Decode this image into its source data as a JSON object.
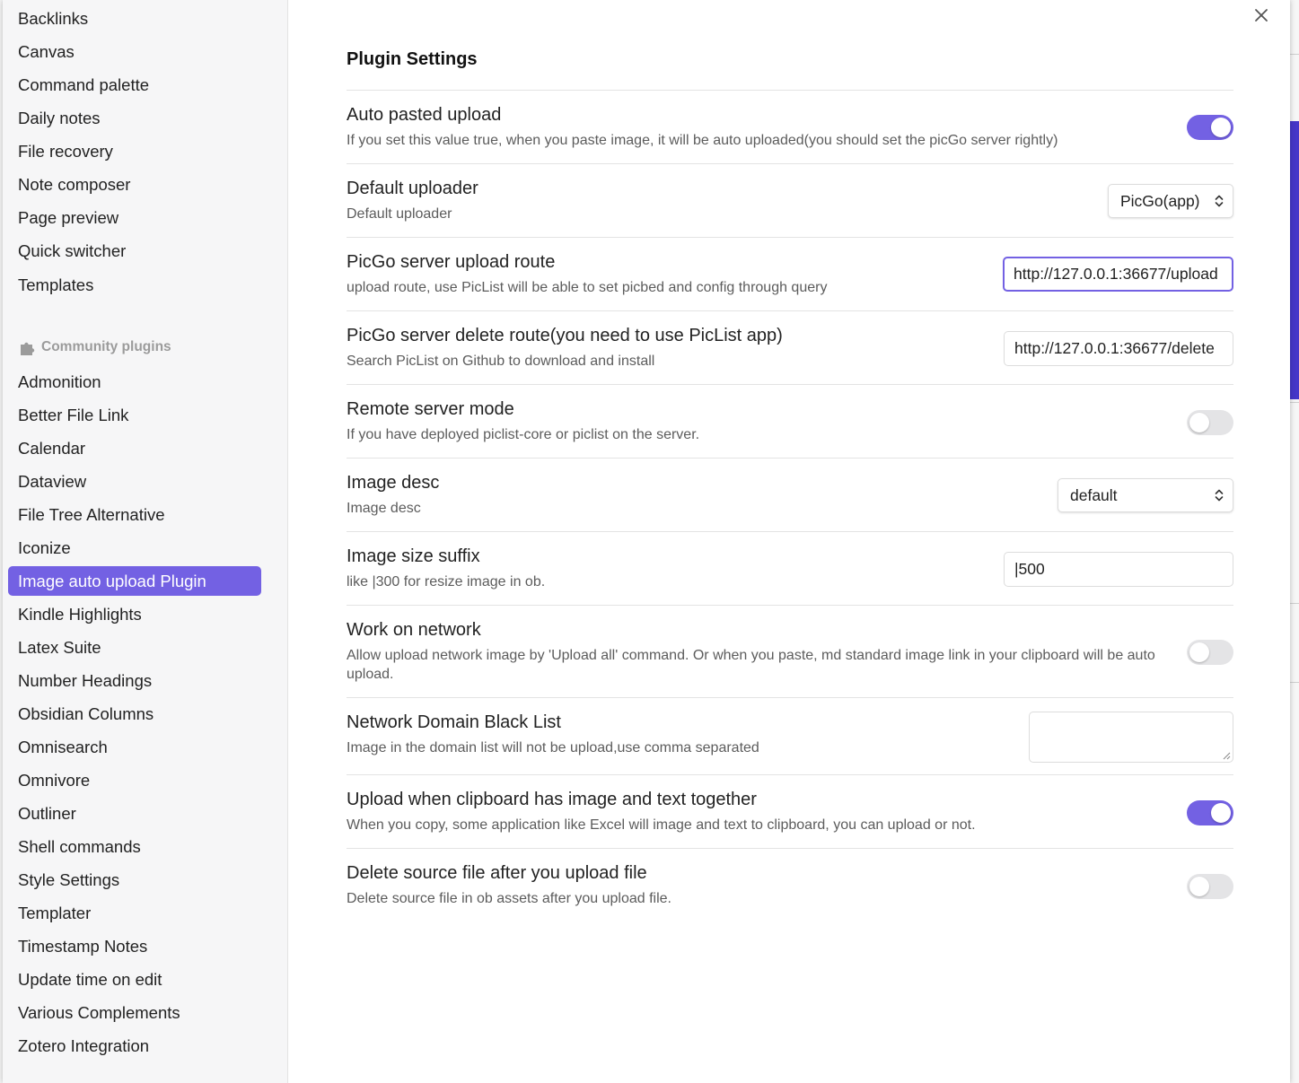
{
  "sidebar": {
    "core_items": [
      "Backlinks",
      "Canvas",
      "Command palette",
      "Daily notes",
      "File recovery",
      "Note composer",
      "Page preview",
      "Quick switcher",
      "Templates"
    ],
    "community_header": "Community plugins",
    "community_items": [
      "Admonition",
      "Better File Link",
      "Calendar",
      "Dataview",
      "File Tree Alternative",
      "Iconize",
      "Image auto upload Plugin",
      "Kindle Highlights",
      "Latex Suite",
      "Number Headings",
      "Obsidian Columns",
      "Omnisearch",
      "Omnivore",
      "Outliner",
      "Shell commands",
      "Style Settings",
      "Templater",
      "Timestamp Notes",
      "Update time on edit",
      "Various Complements",
      "Zotero Integration"
    ],
    "active_item": "Image auto upload Plugin"
  },
  "page": {
    "title": "Plugin Settings"
  },
  "settings": {
    "auto_pasted": {
      "name": "Auto pasted upload",
      "desc": "If you set this value true, when you paste image, it will be auto uploaded(you should set the picGo server rightly)",
      "enabled": true
    },
    "default_uploader": {
      "name": "Default uploader",
      "desc": "Default uploader",
      "value": "PicGo(app)"
    },
    "upload_route": {
      "name": "PicGo server upload route",
      "desc": "upload route, use PicList will be able to set picbed and config through query",
      "value": "http://127.0.0.1:36677/upload"
    },
    "delete_route": {
      "name": "PicGo server delete route(you need to use PicList app)",
      "desc": "Search PicList on Github to download and install",
      "value": "http://127.0.0.1:36677/delete"
    },
    "remote_mode": {
      "name": "Remote server mode",
      "desc": "If you have deployed piclist-core or piclist on the server.",
      "enabled": false
    },
    "image_desc": {
      "name": "Image desc",
      "desc": "Image desc",
      "value": "default"
    },
    "size_suffix": {
      "name": "Image size suffix",
      "desc": "like |300 for resize image in ob.",
      "value": "|500"
    },
    "work_network": {
      "name": "Work on network",
      "desc": "Allow upload network image by 'Upload all' command. Or when you paste, md standard image link in your clipboard will be auto upload.",
      "enabled": false
    },
    "domain_blacklist": {
      "name": "Network Domain Black List",
      "desc": "Image in the domain list will not be upload,use comma separated",
      "value": ""
    },
    "clipboard_both": {
      "name": "Upload when clipboard has image and text together",
      "desc": "When you copy, some application like Excel will image and text to clipboard, you can upload or not.",
      "enabled": true
    },
    "delete_source": {
      "name": "Delete source file after you upload file",
      "desc": "Delete source file in ob assets after you upload file.",
      "enabled": false
    }
  },
  "colors": {
    "accent": "#7361e3",
    "border": "#e3e3e3",
    "muted_text": "#5c5c5c"
  },
  "icons": {
    "close": "close-icon",
    "community": "puzzle-icon",
    "select": "chevron-updown-icon"
  }
}
